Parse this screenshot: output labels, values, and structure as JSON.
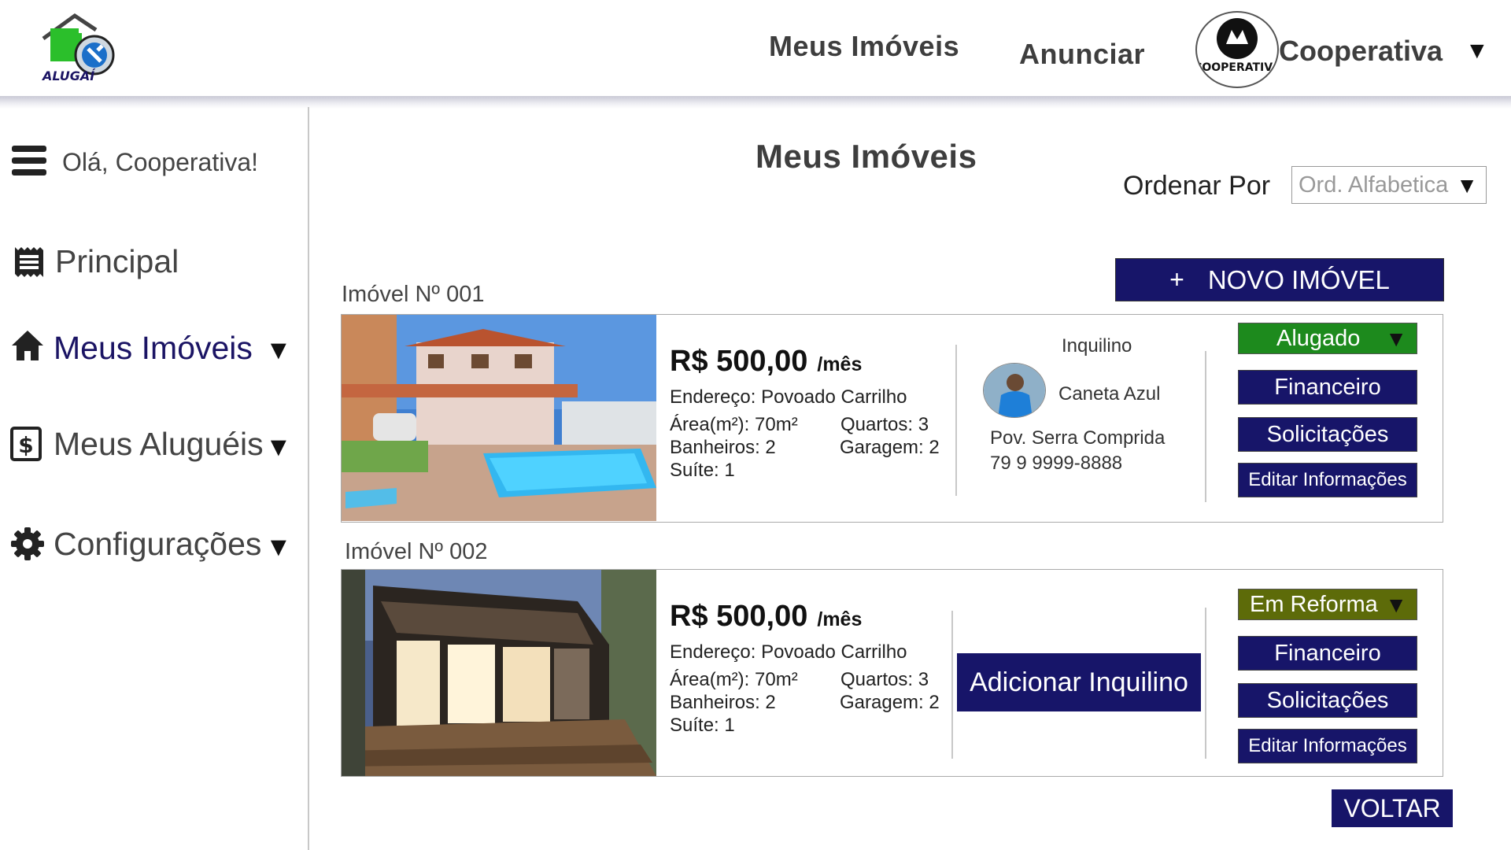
{
  "header": {
    "logo_text": "ALUGAÍ",
    "nav_meus_imoveis": "Meus Imóveis",
    "nav_anunciar": "Anunciar",
    "account_name": "Cooperativa",
    "account_avatar_text": "COOPERATIVA",
    "dropdown_glyph": "▼"
  },
  "sidebar": {
    "greeting": "Olá, Cooperativa!",
    "items": [
      {
        "label": "Principal",
        "icon": "receipt-icon"
      },
      {
        "label": "Meus Imóveis",
        "icon": "home-icon",
        "active": true
      },
      {
        "label": "Meus Aluguéis",
        "icon": "dollar-icon"
      },
      {
        "label": "Configurações",
        "icon": "gear-icon"
      }
    ],
    "arrow": "▼"
  },
  "main": {
    "title": "Meus Imóveis",
    "sort_label": "Ordenar Por",
    "sort_value": "Ord. Alfabetica",
    "new_button_plus": "+",
    "new_button_label": "NOVO IMÓVEL",
    "back_button": "VOLTAR",
    "properties": [
      {
        "label": "Imóvel Nº 001",
        "price": "R$ 500,00",
        "period": "/mês",
        "address": "Endereço: Povoado Carrilho",
        "area": "Área(m²): 70m²",
        "rooms": "Quartos: 3",
        "bathrooms": "Banheiros: 2",
        "garage": "Garagem: 2",
        "suite": "Suíte: 1",
        "tenant": {
          "title": "Inquilino",
          "name": "Caneta Azul",
          "address": "Pov. Serra Comprida",
          "phone": "79 9 9999-8888"
        },
        "status": "Alugado",
        "status_color": "#1d8a1d",
        "buttons": {
          "financeiro": "Financeiro",
          "solicitacoes": "Solicitações",
          "editar": "Editar Informações"
        }
      },
      {
        "label": "Imóvel Nº 002",
        "price": "R$ 500,00",
        "period": "/mês",
        "address": "Endereço: Povoado Carrilho",
        "area": "Área(m²): 70m²",
        "rooms": "Quartos: 3",
        "bathrooms": "Banheiros: 2",
        "garage": "Garagem: 2",
        "suite": "Suíte: 1",
        "add_tenant": "Adicionar Inquilino",
        "status": "Em Reforma",
        "status_color": "#5d6b09",
        "buttons": {
          "financeiro": "Financeiro",
          "solicitacoes": "Solicitações",
          "editar": "Editar Informações"
        }
      }
    ]
  },
  "colors": {
    "primary": "#171569",
    "rented": "#1d8a1d",
    "renovation": "#5d6b09"
  }
}
